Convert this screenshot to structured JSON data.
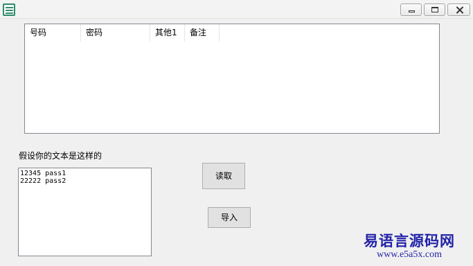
{
  "window": {
    "icon": "app-icon",
    "controls": {
      "minimize": "minimize-icon",
      "maximize": "maximize-icon",
      "close": "close-icon"
    }
  },
  "listview": {
    "columns": [
      "号码",
      "密码",
      "其他1",
      "备注"
    ]
  },
  "hint_label": "假设你的文本是这样的",
  "textarea": {
    "lines": [
      "12345 pass1",
      "22222 pass2"
    ]
  },
  "buttons": {
    "read_label": "读取",
    "import_label": "导入"
  },
  "watermark": {
    "title": "易语言源码网",
    "url": "www.e5a5x.com",
    "color": "#2222a8"
  }
}
